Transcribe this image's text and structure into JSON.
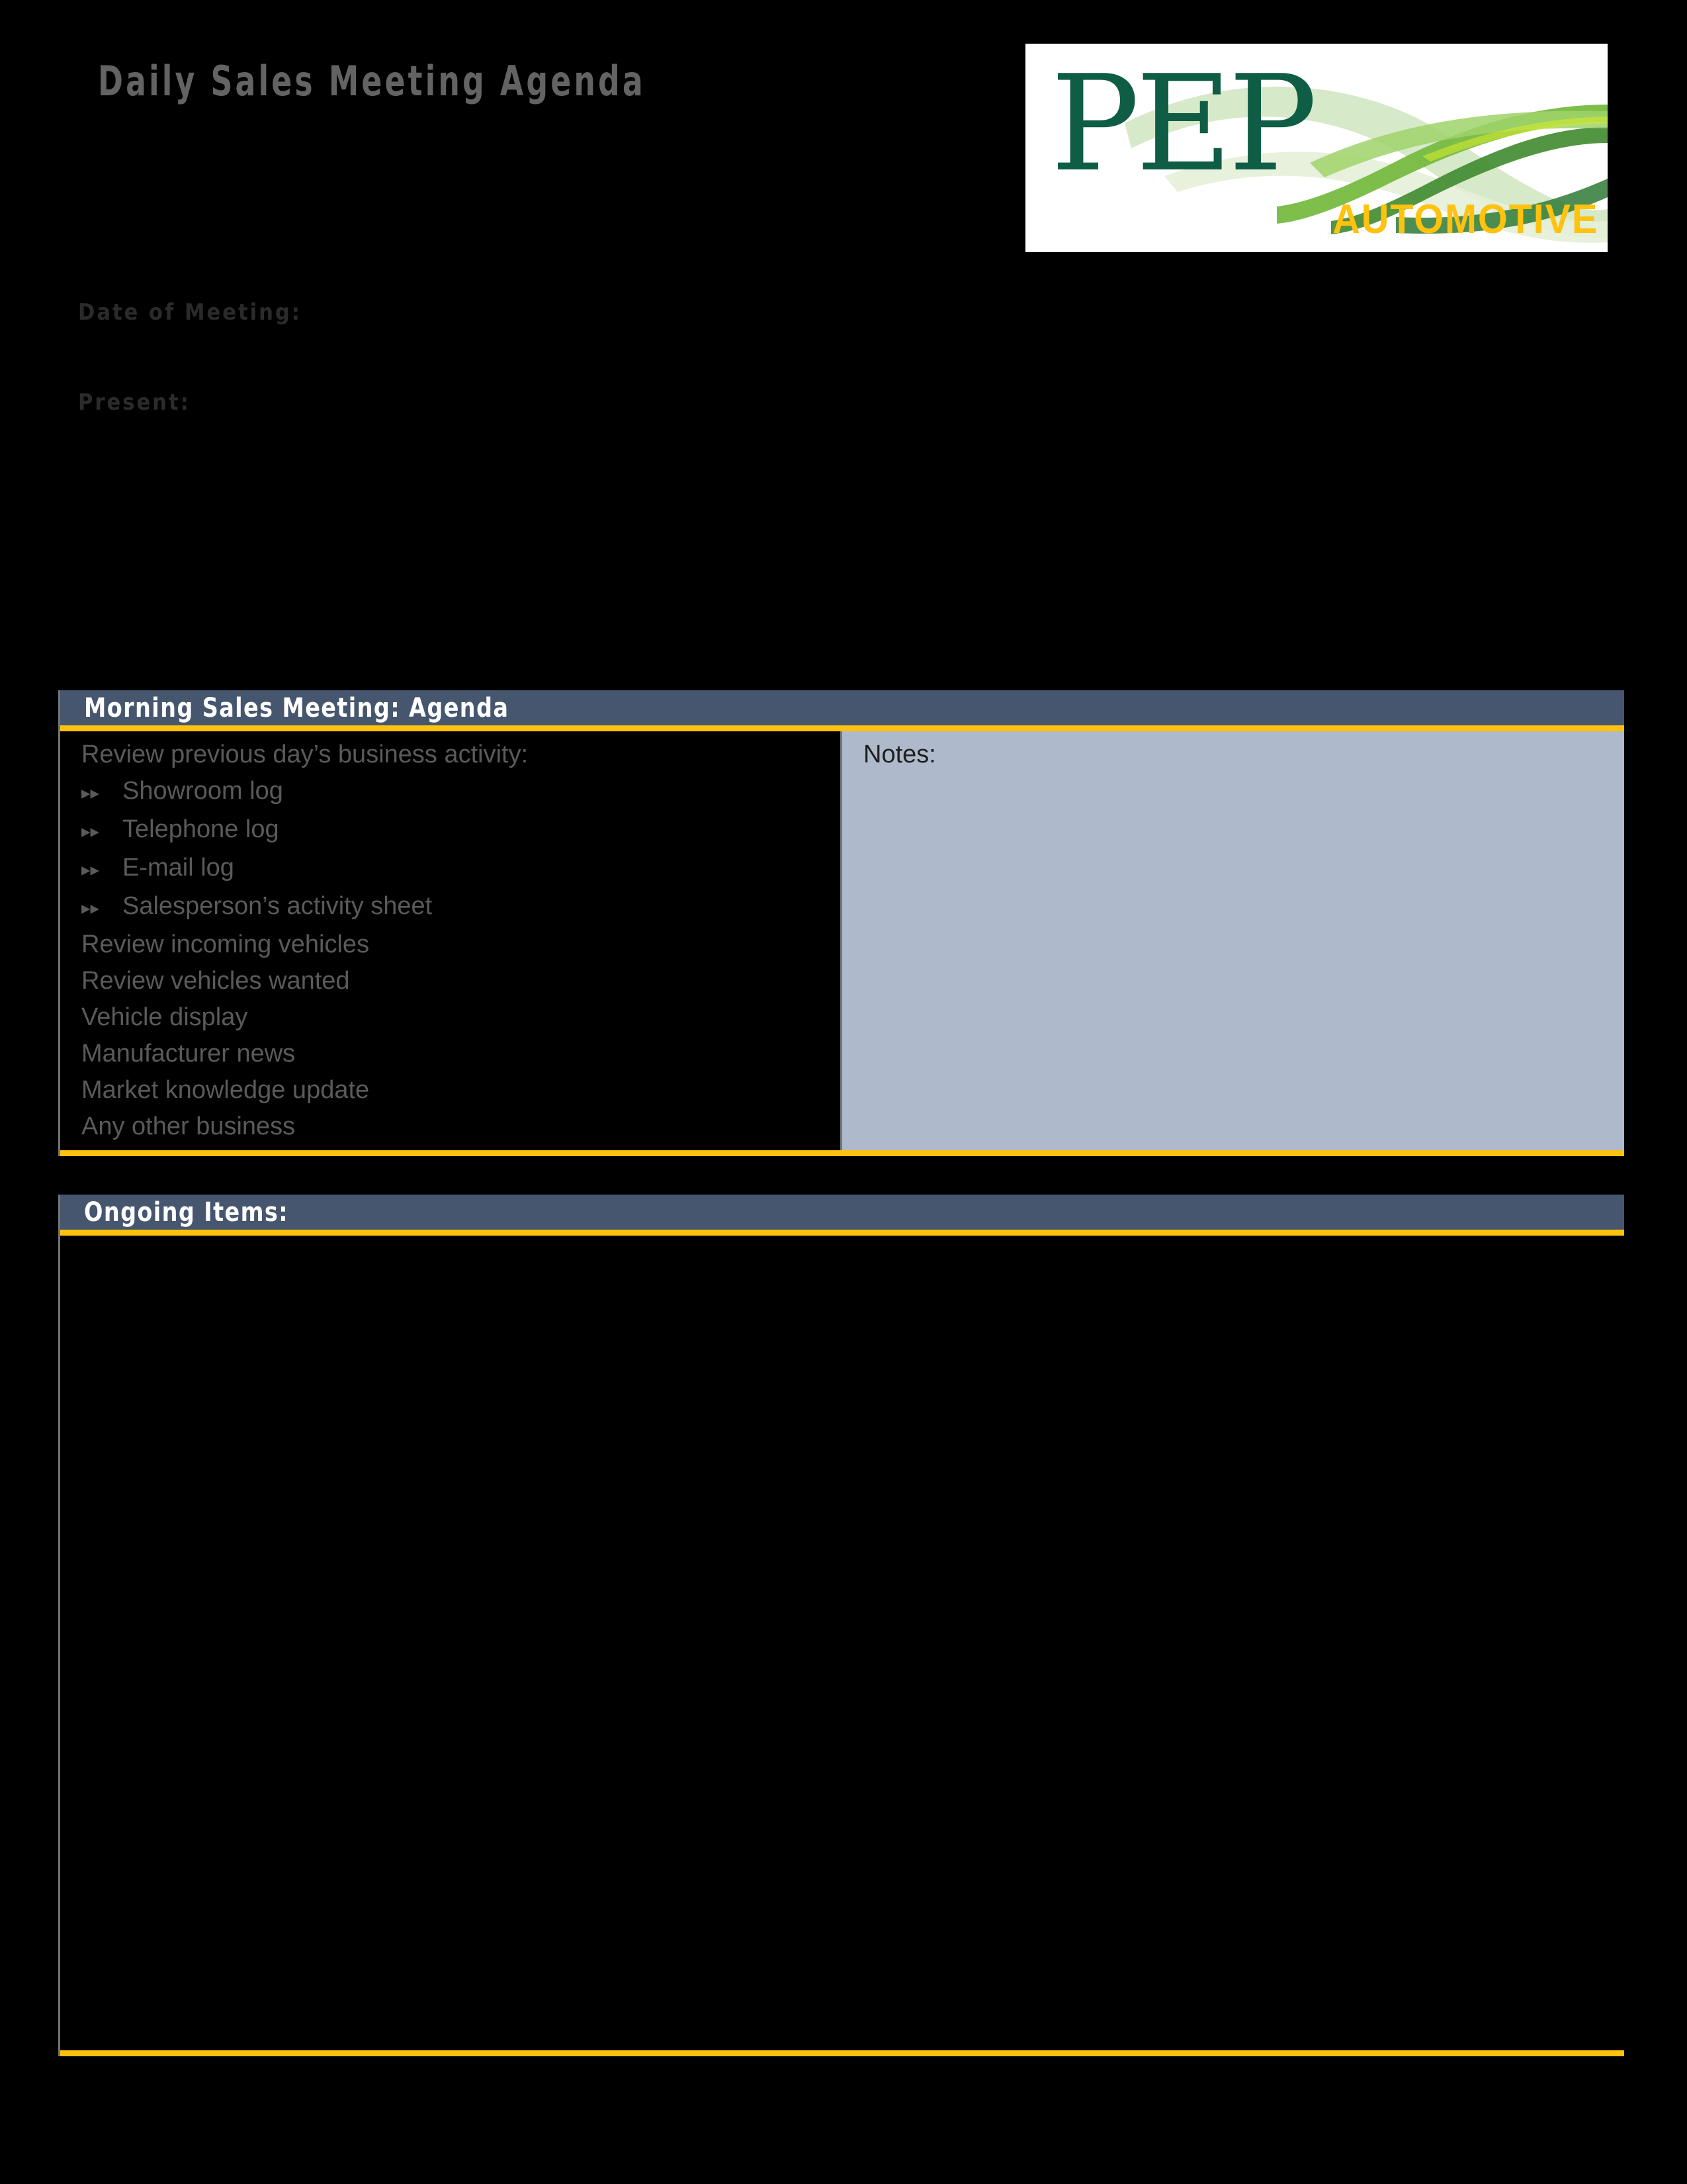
{
  "document": {
    "title": "Daily Sales Meeting Agenda",
    "background_color": "#000000"
  },
  "logo": {
    "name": "pep-automotive-logo",
    "wordmark": "PEP",
    "tagline": "AUTOMOTIVE",
    "wordmark_color": "#0f5d45",
    "tagline_color": "#ffc20e",
    "panel_color": "#ffffff"
  },
  "fields": [
    {
      "name": "date-of-meeting",
      "label": "Date of Meeting:",
      "value": ""
    },
    {
      "name": "present",
      "label": "Present:",
      "value": ""
    }
  ],
  "agenda_section": {
    "header": "Morning Sales Meeting: Agenda",
    "header_bg": "#46566e",
    "accent": "#ffc20e",
    "notes_label": "Notes:",
    "notes_bg": "#aebacc",
    "notes_value": "",
    "items": [
      {
        "text": "Review previous day’s business activity:",
        "level": 0
      },
      {
        "text": "Showroom log",
        "level": 1,
        "marker": "▸▸"
      },
      {
        "text": "Telephone log",
        "level": 1,
        "marker": "▸▸"
      },
      {
        "text": "E-mail log",
        "level": 1,
        "marker": "▸▸"
      },
      {
        "text": "Salesperson’s activity sheet",
        "level": 1,
        "marker": "▸▸"
      },
      {
        "text": "Review incoming vehicles",
        "level": 0
      },
      {
        "text": "Review vehicles wanted",
        "level": 0
      },
      {
        "text": "Vehicle display",
        "level": 0
      },
      {
        "text": "Manufacturer news",
        "level": 0
      },
      {
        "text": "Market knowledge update",
        "level": 0
      },
      {
        "text": "Any other business",
        "level": 0
      }
    ]
  },
  "ongoing_section": {
    "header": "Ongoing Items:",
    "header_bg": "#46566e",
    "accent": "#ffc20e",
    "value": ""
  }
}
